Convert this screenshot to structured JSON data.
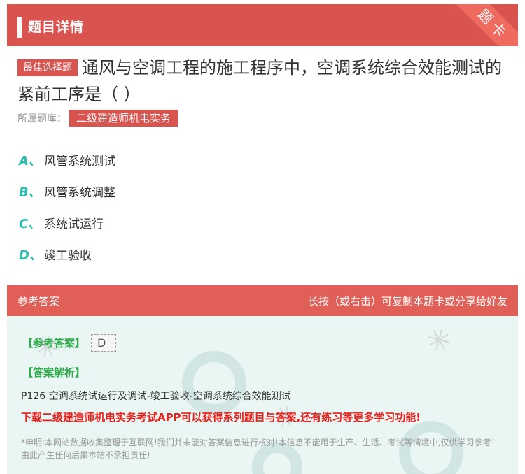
{
  "header": {
    "title": "题目详情",
    "ribbon": "题卡"
  },
  "question": {
    "badge": "最佳选择题",
    "text": "通风与空调工程的施工程序中，空调系统综合效能测试的紧前工序是（   ）",
    "bank_label": "所属题库：",
    "bank_name": "二级建造师机电实务"
  },
  "options": [
    {
      "letter": "A、",
      "text": "风管系统测试"
    },
    {
      "letter": "B、",
      "text": "风管系统调整"
    },
    {
      "letter": "C、",
      "text": "系统试运行"
    },
    {
      "letter": "D、",
      "text": "竣工验收"
    }
  ],
  "answer": {
    "header_left": "参考答案",
    "header_right": "长按（或右击）可复制本题卡或分享给好友",
    "ref_label": "【参考答案】",
    "ref_value": "D",
    "analysis_label": "【答案解析】",
    "analysis_text": "P126 空调系统试运行及调试-竣工验收-空调系统综合效能测试",
    "promo": "下载二级建造师机电实务考试APP可以获得系列题目与答案,还有练习等更多学习功能!",
    "disclaimer": "*申明:本网站数据收集整理于互联网!我们并未能对答案信息进行核对!本信息不能用于生产、生活、考试等情境中,仅供学习参考！由此产生任何后果本站不承担责任!"
  },
  "colors": {
    "accent": "#d9534f",
    "letter": "#2bbcb0",
    "promo": "#e8201b",
    "green": "#2ea84a"
  }
}
